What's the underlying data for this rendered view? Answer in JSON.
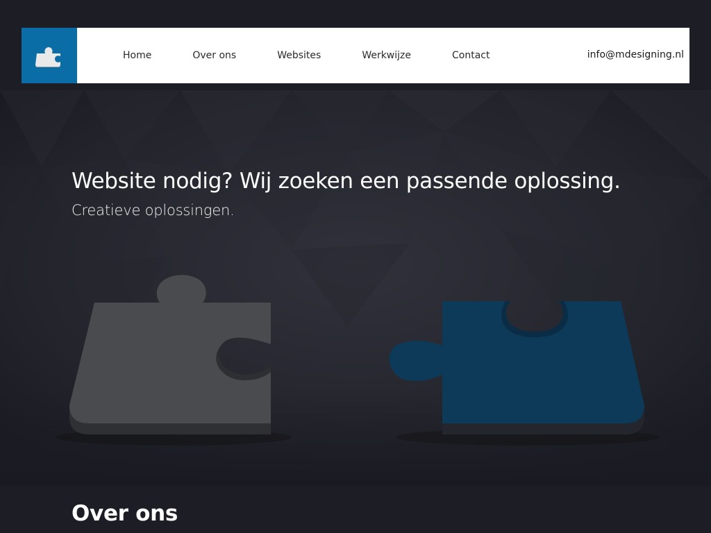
{
  "header": {
    "logo_icon": "puzzle-piece-icon",
    "nav": [
      {
        "label": "Home"
      },
      {
        "label": "Over ons"
      },
      {
        "label": "Websites"
      },
      {
        "label": "Werkwijze"
      },
      {
        "label": "Contact"
      }
    ],
    "email": "info@mdesigning.nl"
  },
  "hero": {
    "title": "Website nodig? Wij zoeken een passende oplossing.",
    "subtitle": "Creatieve oplossingen.",
    "illustration": "puzzle-pieces-icon"
  },
  "section": {
    "title": "Over ons"
  },
  "colors": {
    "accent": "#0b6da6",
    "background": "#1c1d25",
    "puzzle_gray": "#4a4b4f",
    "puzzle_blue": "#0d3a58"
  }
}
